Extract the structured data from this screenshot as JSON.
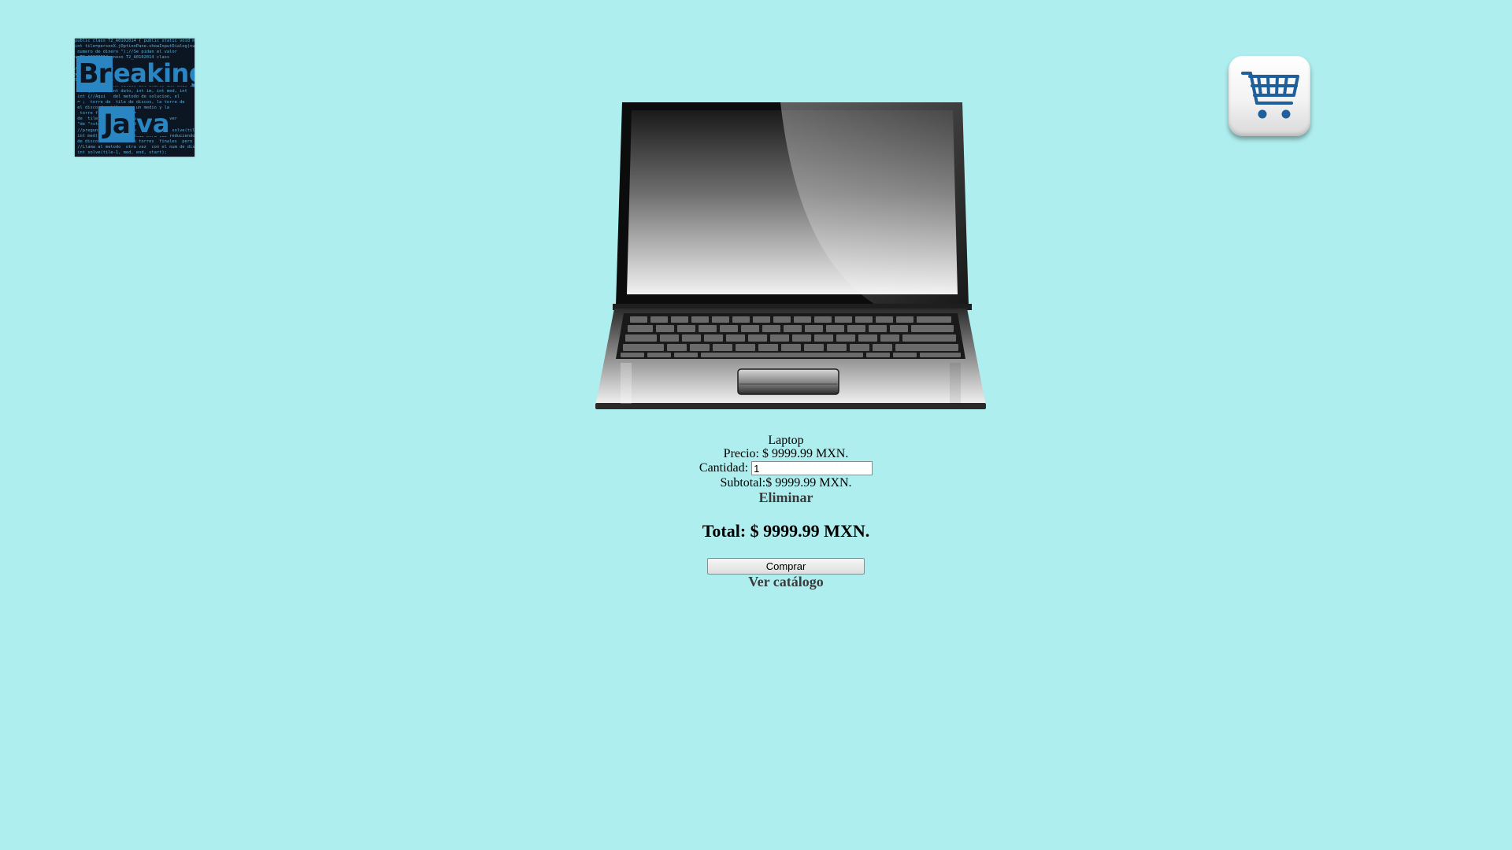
{
  "logo": {
    "word_top": "Breaking",
    "word_top_tile": "Br",
    "word_top_rest": "eaking",
    "word_bottom": "Java",
    "word_bottom_tile": "Ja",
    "word_bottom_rest": "va"
  },
  "header": {
    "cart_icon": "shopping-cart-icon"
  },
  "product": {
    "image_icon": "laptop-image",
    "name": "Laptop",
    "price_text": "Precio: $ 9999.99 MXN.",
    "quantity_label": "Cantidad:",
    "quantity_value": "1",
    "subtotal_text": "Subtotal:$ 9999.99 MXN.",
    "delete_label": "Eliminar"
  },
  "summary": {
    "total_text": "Total: $ 9999.99 MXN.",
    "buy_label": "Comprar",
    "catalog_label": "Ver catálogo"
  },
  "colors": {
    "background": "#afeeee",
    "logo_blue": "#2a86c2",
    "cart_blue": "#1f5f9c"
  }
}
